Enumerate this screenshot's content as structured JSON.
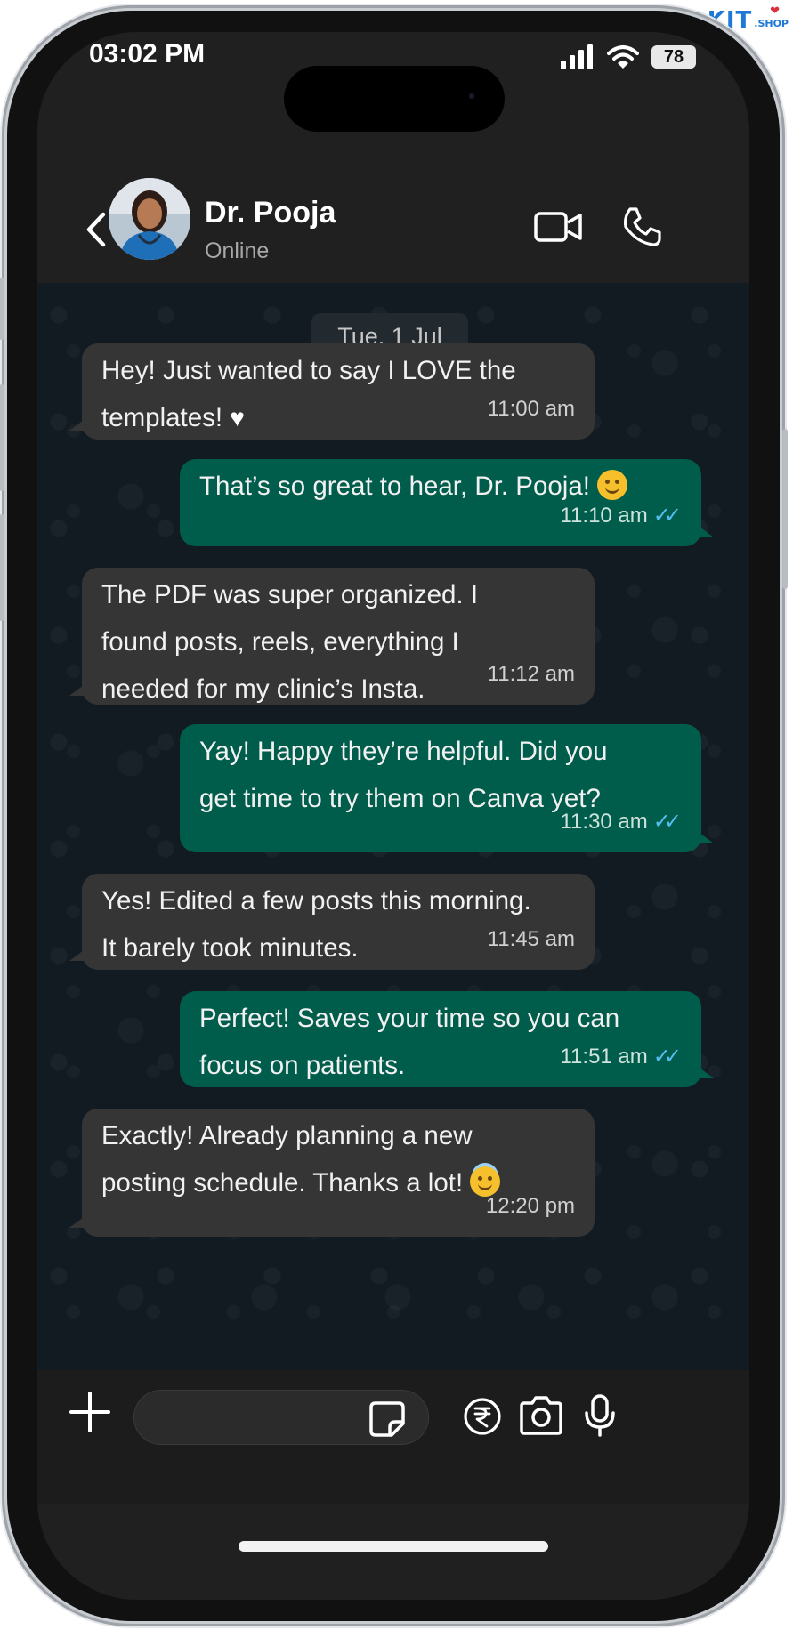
{
  "brand": {
    "name": "MEDKIT",
    "suffix": ".SHOP",
    "accent": "#1e78d6"
  },
  "status_bar": {
    "time": "03:02 PM",
    "battery": "78"
  },
  "header": {
    "name": "Dr. Pooja",
    "status": "Online",
    "icons": [
      "back-arrow-icon",
      "video-call-icon",
      "phone-call-icon"
    ]
  },
  "chat": {
    "date": "Tue, 1 Jul",
    "messages": [
      {
        "direction": "in",
        "text": "Hey! Just wanted to say I LOVE the\ntemplates!",
        "emoji": "white-heart",
        "time": "11:00 am"
      },
      {
        "direction": "out",
        "text": "That’s so great to hear, Dr. Pooja!",
        "emoji": "smiling-face",
        "time": "11:10 am",
        "read": true
      },
      {
        "direction": "in",
        "text": "The PDF was super organized. I\nfound posts, reels, everything I\nneeded for my clinic’s Insta.",
        "time": "11:12 am"
      },
      {
        "direction": "out",
        "text": "Yay! Happy they’re helpful. Did you\nget time to try them on Canva yet?",
        "time": "11:30 am",
        "read": true
      },
      {
        "direction": "in",
        "text": "Yes! Edited a few posts this morning.\nIt barely took minutes.",
        "time": "11:45 am"
      },
      {
        "direction": "out",
        "text": "Perfect! Saves your time so you can\nfocus on patients.",
        "time": "11:51 am",
        "read": true
      },
      {
        "direction": "in",
        "text": "Exactly! Already planning a new\nposting schedule. Thanks a lot!",
        "emoji": "smiling-face-with-halo",
        "time": "12:20 pm"
      }
    ]
  },
  "input_bar": {
    "value": "",
    "icons": [
      "plus-icon",
      "sticker-icon",
      "rupee-icon",
      "camera-icon",
      "microphone-icon"
    ]
  },
  "colors": {
    "incoming_bubble": "#353535",
    "outgoing_bubble": "#005c4b",
    "chat_background": "#121b22",
    "read_ticks": "#53bdeb"
  }
}
